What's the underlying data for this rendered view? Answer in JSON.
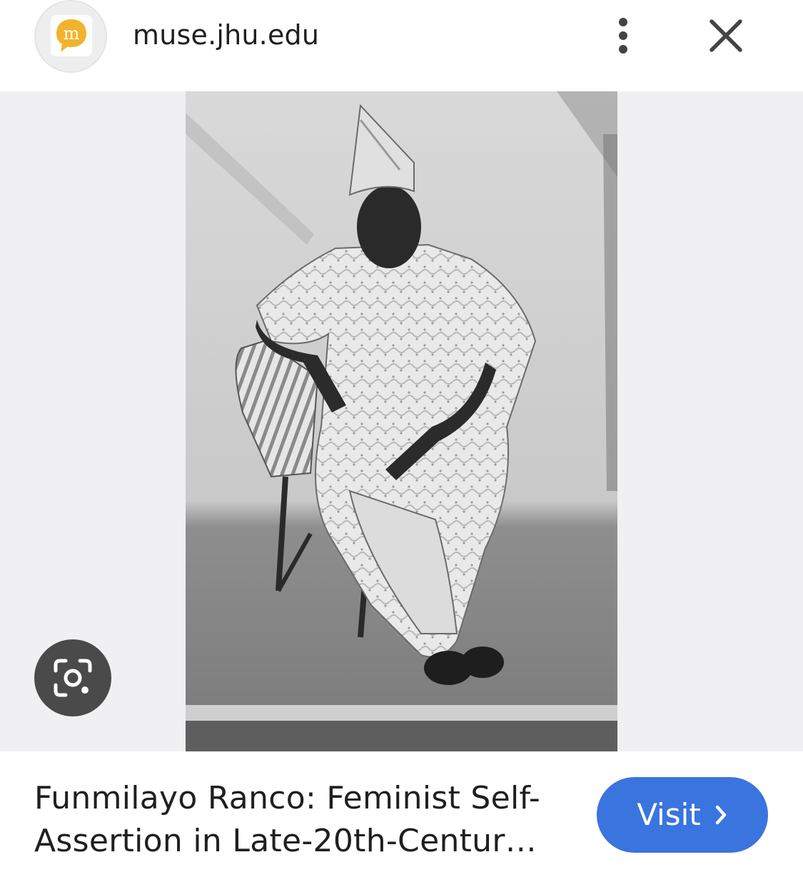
{
  "header": {
    "site_name": "muse.jhu.edu",
    "favicon_icon": "project-muse-logo-icon",
    "more_icon": "more-vert-icon",
    "close_icon": "close-icon"
  },
  "image": {
    "description_icon": "photo-seated-person"
  },
  "lens": {
    "icon": "google-lens-icon"
  },
  "result": {
    "title_line1": "Funmilayo Ranco: Feminist Self-",
    "title_line2": "Assertion in Late-20th-Centur…",
    "visit_label": "Visit",
    "visit_icon": "chevron-right-icon"
  },
  "colors": {
    "accent": "#3a74de",
    "logo_yellow": "#f2b32c",
    "lens_bg": "#4a4a4a",
    "stage_bg": "#f0f0f2"
  }
}
